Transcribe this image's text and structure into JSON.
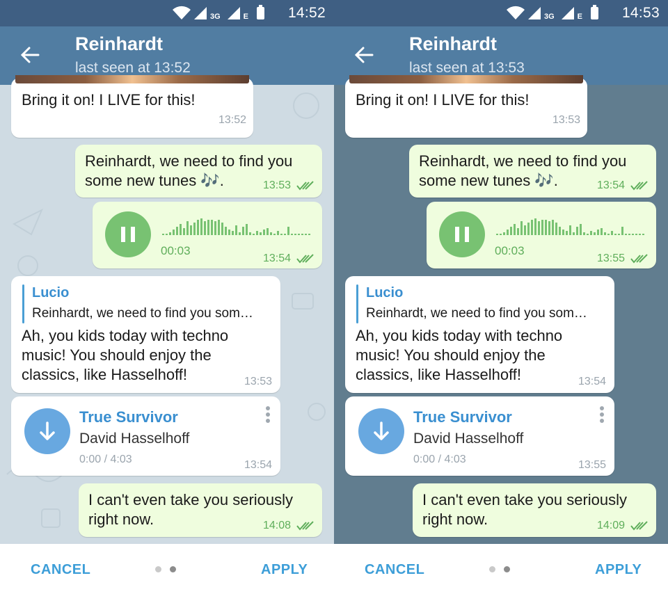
{
  "panels": [
    {
      "status": {
        "time": "14:52",
        "network1": "3G",
        "network2": "E"
      },
      "header": {
        "title": "Reinhardt",
        "subtitle": "last seen at 13:52"
      },
      "messages": {
        "m1": {
          "text": "Bring it on! I LIVE for this!",
          "time": "13:52"
        },
        "m2": {
          "line1": "Reinhardt, we need to find you",
          "line2": "some new tunes 🎶.",
          "time": "13:53"
        },
        "m3": {
          "duration": "00:03",
          "time": "13:54"
        },
        "m4": {
          "reply_name": "Lucio",
          "reply_text": "Reinhardt, we need to find you som…",
          "line1": "Ah, you kids today with techno",
          "line2": "music! You should enjoy the",
          "line3": "classics, like Hasselhoff!",
          "time": "13:53"
        },
        "m5": {
          "song_title": "True Survivor",
          "artist": "David Hasselhoff",
          "progress": "0:00 / 4:03",
          "time": "13:54"
        },
        "m6": {
          "line1": "I can't even take you seriously",
          "line2": "right now.",
          "time": "14:08"
        }
      }
    },
    {
      "status": {
        "time": "14:53",
        "network1": "3G",
        "network2": "E"
      },
      "header": {
        "title": "Reinhardt",
        "subtitle": "last seen at 13:53"
      },
      "messages": {
        "m1": {
          "text": "Bring it on! I LIVE for this!",
          "time": "13:53"
        },
        "m2": {
          "line1": "Reinhardt, we need to find you",
          "line2": "some new tunes 🎶.",
          "time": "13:54"
        },
        "m3": {
          "duration": "00:03",
          "time": "13:55"
        },
        "m4": {
          "reply_name": "Lucio",
          "reply_text": "Reinhardt, we need to find you som…",
          "line1": "Ah, you kids today with techno",
          "line2": "music! You should enjoy the",
          "line3": "classics, like Hasselhoff!",
          "time": "13:54"
        },
        "m5": {
          "song_title": "True Survivor",
          "artist": "David Hasselhoff",
          "progress": "0:00 / 4:03",
          "time": "13:55"
        },
        "m6": {
          "line1": "I can't even take you seriously",
          "line2": "right now.",
          "time": "14:09"
        }
      }
    }
  ],
  "bottom": {
    "cancel_label": "CANCEL",
    "apply_label": "APPLY"
  },
  "colors": {
    "header": "#517da2",
    "statusbar": "#3f5f83",
    "outgoing": "#effdde",
    "accent": "#3d9ed8",
    "voice": "#78c272",
    "left_wallpaper": "#cfdbe3",
    "right_wallpaper": "#617d8f"
  }
}
